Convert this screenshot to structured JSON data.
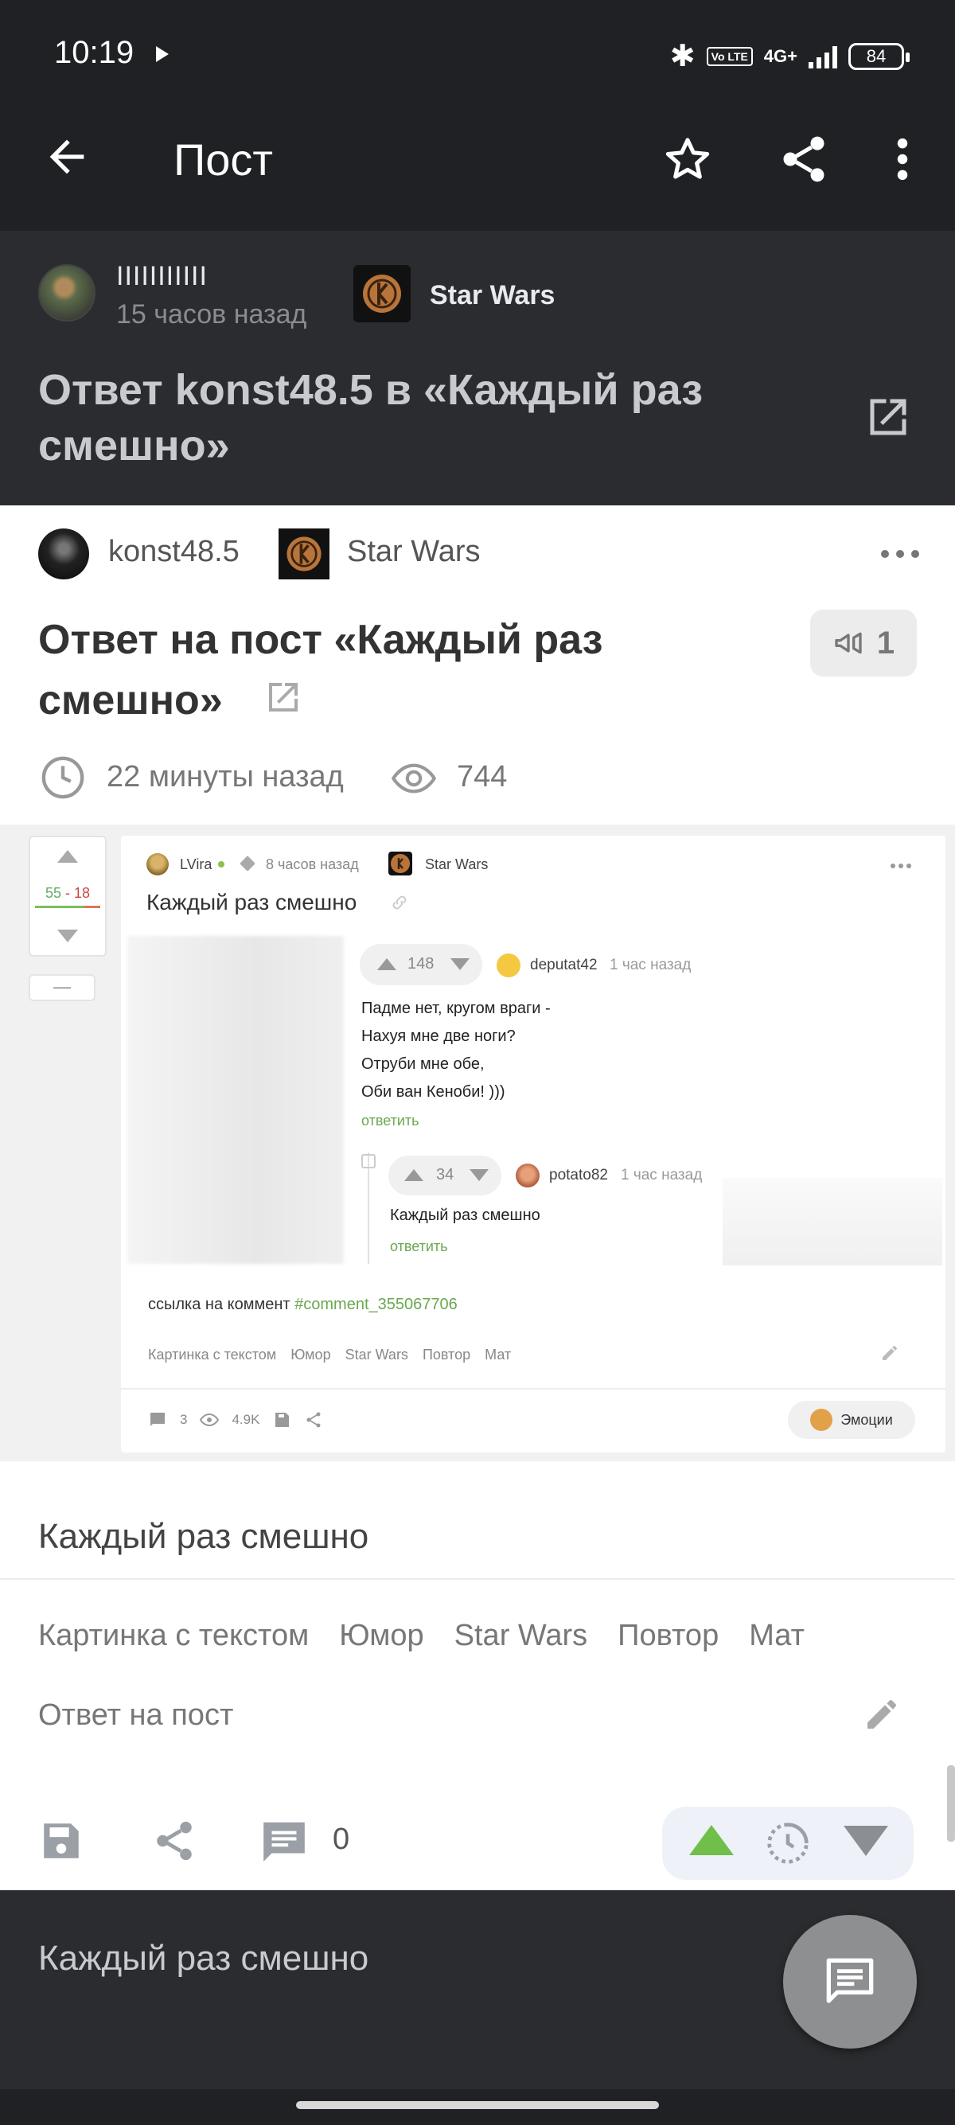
{
  "status_bar": {
    "time": "10:19",
    "network": "4G+",
    "volte": "Vo LTE",
    "battery": "84"
  },
  "app_bar": {
    "title": "Пост",
    "icons": [
      "back-arrow-icon",
      "star-icon",
      "share-icon",
      "more-vert-icon"
    ]
  },
  "post_header": {
    "author_name": "IIIIIIIIIII",
    "time": "15 часов назад",
    "community": "Star Wars",
    "title": "Ответ konst48.5 в «Каждый раз смешно»"
  },
  "inner_post": {
    "author": "konst48.5",
    "community": "Star Wars",
    "title": "Ответ на пост «Каждый раз смешно»",
    "badge_count": "1",
    "time": "22 минуты назад",
    "views": "744"
  },
  "embed": {
    "vote_score_plus": "55",
    "vote_score_sep": " - ",
    "vote_score_minus": "18",
    "collapse_label": "—",
    "author": "LVira",
    "time": "8 часов назад",
    "community": "Star Wars",
    "title": "Каждый раз смешно",
    "comment1": {
      "score": "148",
      "author": "deputat42",
      "time": "1 час назад",
      "lines": [
        "Падме нет, кругом враги -",
        "Нахуя мне две ноги?",
        "Отруби мне обе,",
        "Оби ван Кеноби! )))"
      ],
      "reply": "ответить"
    },
    "comment2": {
      "score": "34",
      "author": "potato82",
      "time": "1 час назад",
      "text": "Каждый раз смешно",
      "reply": "ответить"
    },
    "link_label": "ссылка на коммент",
    "link_hash": "#comment_355067706",
    "tags": [
      "Картинка с текстом",
      "Юмор",
      "Star Wars",
      "Повтор",
      "Мат"
    ],
    "footer": {
      "comments": "3",
      "views": "4.9K"
    },
    "emotions_label": "Эмоции"
  },
  "post_body": {
    "text": "Каждый раз смешно",
    "tags": [
      "Картинка с текстом",
      "Юмор",
      "Star Wars",
      "Повтор",
      "Мат"
    ],
    "reply_to": "Ответ на пост"
  },
  "actions": {
    "comments_count": "0"
  },
  "bottom": {
    "text": "Каждый раз смешно"
  },
  "colors": {
    "dark_bg": "#202124",
    "header_bg": "#2b2c2f",
    "upvote": "#6fbf4a",
    "link_green": "#6aa84f"
  }
}
